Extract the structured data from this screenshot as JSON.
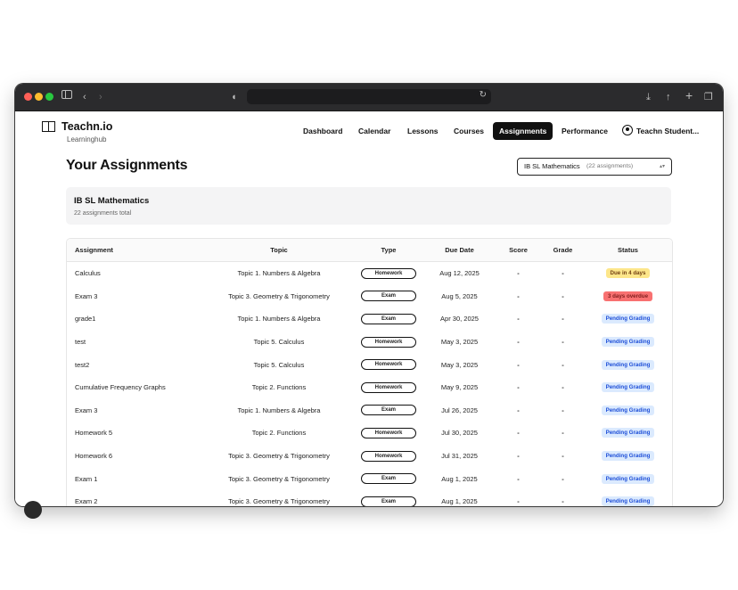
{
  "app": {
    "brand": "Teachn.io",
    "subtitle": "Learninghub"
  },
  "nav": {
    "items": [
      "Dashboard",
      "Calendar",
      "Lessons",
      "Courses",
      "Assignments",
      "Performance"
    ],
    "active": "Assignments",
    "user": "Teachn Student..."
  },
  "page": {
    "title": "Your Assignments",
    "course_select": {
      "label": "IB SL Mathematics",
      "count": "(22 assignments)"
    },
    "course_card": {
      "title": "IB SL Mathematics",
      "subtitle": "22 assignments total"
    }
  },
  "table": {
    "headers": [
      "Assignment",
      "Topic",
      "Type",
      "Due Date",
      "Score",
      "Grade",
      "Status"
    ],
    "rows": [
      {
        "name": "Calculus",
        "topic": "Topic 1. Numbers & Algebra",
        "type": "Homework",
        "due": "Aug 12, 2025",
        "score": "-",
        "grade": "-",
        "status": "Due in 4 days",
        "status_kind": "due"
      },
      {
        "name": "Exam 3",
        "topic": "Topic 3. Geometry & Trigonometry",
        "type": "Exam",
        "due": "Aug 5, 2025",
        "score": "-",
        "grade": "-",
        "status": "3 days overdue",
        "status_kind": "overdue"
      },
      {
        "name": "grade1",
        "topic": "Topic 1. Numbers & Algebra",
        "type": "Exam",
        "due": "Apr 30, 2025",
        "score": "-",
        "grade": "-",
        "status": "Pending Grading",
        "status_kind": "pending"
      },
      {
        "name": "test",
        "topic": "Topic 5. Calculus",
        "type": "Homework",
        "due": "May 3, 2025",
        "score": "-",
        "grade": "-",
        "status": "Pending Grading",
        "status_kind": "pending"
      },
      {
        "name": "test2",
        "topic": "Topic 5. Calculus",
        "type": "Homework",
        "due": "May 3, 2025",
        "score": "-",
        "grade": "-",
        "status": "Pending Grading",
        "status_kind": "pending"
      },
      {
        "name": "Cumulative Frequency Graphs",
        "topic": "Topic 2. Functions",
        "type": "Homework",
        "due": "May 9, 2025",
        "score": "-",
        "grade": "-",
        "status": "Pending Grading",
        "status_kind": "pending"
      },
      {
        "name": "Exam 3",
        "topic": "Topic 1. Numbers & Algebra",
        "type": "Exam",
        "due": "Jul 26, 2025",
        "score": "-",
        "grade": "-",
        "status": "Pending Grading",
        "status_kind": "pending"
      },
      {
        "name": "Homework 5",
        "topic": "Topic 2. Functions",
        "type": "Homework",
        "due": "Jul 30, 2025",
        "score": "-",
        "grade": "-",
        "status": "Pending Grading",
        "status_kind": "pending"
      },
      {
        "name": "Homework 6",
        "topic": "Topic 3. Geometry & Trigonometry",
        "type": "Homework",
        "due": "Jul 31, 2025",
        "score": "-",
        "grade": "-",
        "status": "Pending Grading",
        "status_kind": "pending"
      },
      {
        "name": "Exam 1",
        "topic": "Topic 3. Geometry & Trigonometry",
        "type": "Exam",
        "due": "Aug 1, 2025",
        "score": "-",
        "grade": "-",
        "status": "Pending Grading",
        "status_kind": "pending"
      },
      {
        "name": "Exam 2",
        "topic": "Topic 3. Geometry & Trigonometry",
        "type": "Exam",
        "due": "Aug 1, 2025",
        "score": "-",
        "grade": "-",
        "status": "Pending Grading",
        "status_kind": "pending"
      }
    ]
  },
  "icons": {
    "browser": [
      "sidebar-icon",
      "back-icon",
      "forward-icon",
      "shield-icon",
      "reload-icon",
      "download-icon",
      "share-icon",
      "new-tab-icon",
      "tabs-icon"
    ],
    "user": "user-circle-icon",
    "select_arrow": "chevron-updown-icon"
  },
  "colors": {
    "nav_active_bg": "#111111",
    "pending": "#dbeafe",
    "due": "#fde68a",
    "overdue": "#f87171"
  }
}
